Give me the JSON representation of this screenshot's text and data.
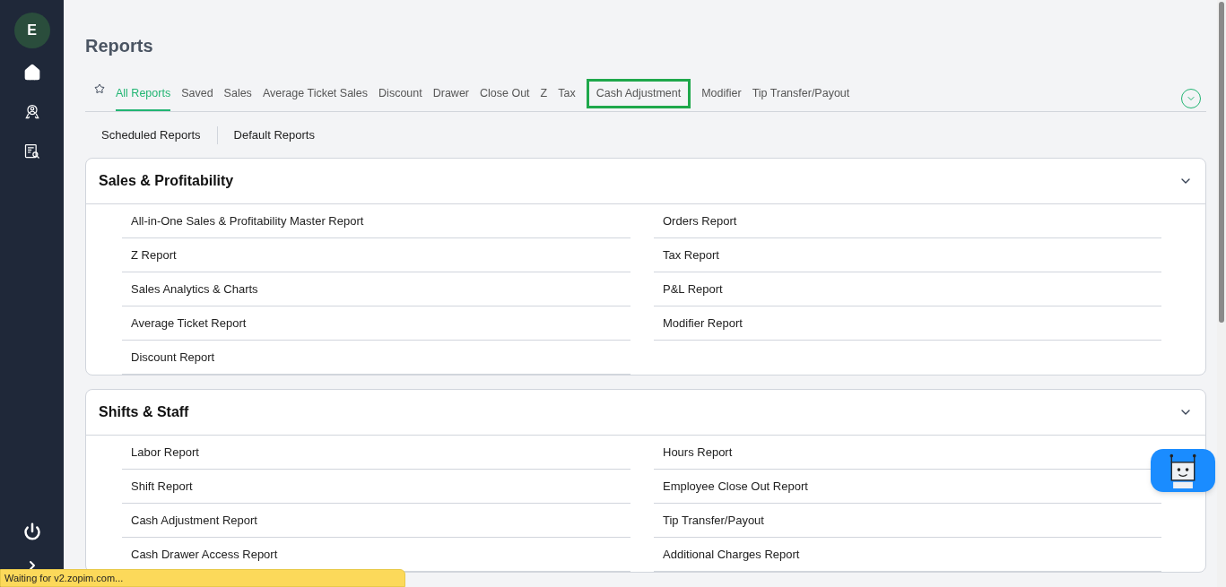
{
  "sidebar": {
    "avatar": "E",
    "items": [
      {
        "kind": "home"
      },
      {
        "kind": "staff"
      },
      {
        "kind": "reports"
      }
    ]
  },
  "title": "Reports",
  "tabs": [
    {
      "label": "All Reports",
      "selected": true,
      "highlighted": false
    },
    {
      "label": "Saved",
      "selected": false,
      "highlighted": false
    },
    {
      "label": "Sales",
      "selected": false,
      "highlighted": false
    },
    {
      "label": "Average Ticket Sales",
      "selected": false,
      "highlighted": false
    },
    {
      "label": "Discount",
      "selected": false,
      "highlighted": false
    },
    {
      "label": "Drawer",
      "selected": false,
      "highlighted": false
    },
    {
      "label": "Close Out",
      "selected": false,
      "highlighted": false
    },
    {
      "label": "Z",
      "selected": false,
      "highlighted": false
    },
    {
      "label": "Tax",
      "selected": false,
      "highlighted": false
    },
    {
      "label": "Cash Adjustment",
      "selected": false,
      "highlighted": true
    },
    {
      "label": "Modifier",
      "selected": false,
      "highlighted": false
    },
    {
      "label": "Tip Transfer/Payout",
      "selected": false,
      "highlighted": false
    }
  ],
  "sub_links": [
    "Scheduled Reports",
    "Default Reports"
  ],
  "sections": [
    {
      "title": "Sales & Profitability",
      "expanded": true,
      "left": [
        "All-in-One Sales & Profitability Master Report",
        "Z Report",
        "Sales Analytics & Charts",
        "Average Ticket Report",
        "Discount Report"
      ],
      "right": [
        "Orders Report",
        "Tax Report",
        "P&L Report",
        "Modifier Report"
      ]
    },
    {
      "title": "Shifts & Staff",
      "expanded": true,
      "left": [
        "Labor Report",
        "Shift Report",
        "Cash Adjustment Report",
        "Cash Drawer Access Report"
      ],
      "right": [
        "Hours Report",
        "Employee Close Out Report",
        "Tip Transfer/Payout",
        "Additional Charges Report"
      ]
    }
  ],
  "status_bar": "Waiting for v2.zopim.com..."
}
